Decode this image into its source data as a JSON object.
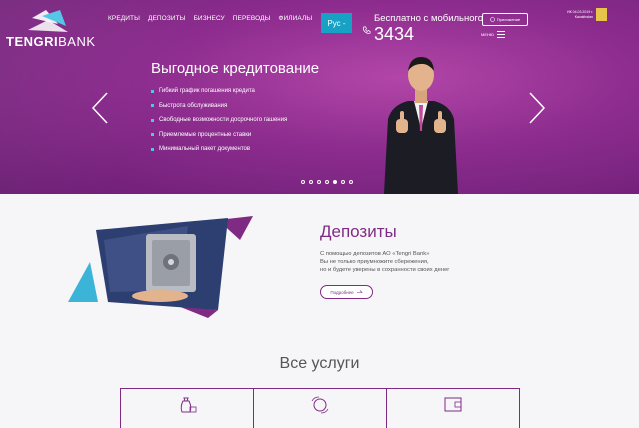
{
  "brand": {
    "name_bold": "TENGRI",
    "name_thin": "BANK"
  },
  "nav": [
    "КРЕДИТЫ",
    "ДЕПОЗИТЫ",
    "БИЗНЕСУ",
    "ПЕРЕВОДЫ",
    "ФИЛИАЛЫ"
  ],
  "header": {
    "lang": "Рус -",
    "phone_caption": "Бесплатно с мобильного",
    "phone_number": "3434",
    "app_button": "Приложение",
    "menu_label": "МЕНЮ",
    "corner_line1": "ИК 04.03.2019 г.",
    "corner_line2": "Kazakhstan"
  },
  "hero": {
    "title": "Выгодное кредитование",
    "bullets": [
      "Гибкий график погашения кредита",
      "Быстрота обслуживания",
      "Свободные возможности досрочного гашения",
      "Приемлемые процентные ставки",
      "Минимальный пакет документов"
    ],
    "slide_count": 7,
    "active_slide": 5
  },
  "deposits": {
    "title": "Депозиты",
    "line1": "С помощью депозитов АО «Tengri Bank»",
    "line2": "Вы не только приумножите сбережения,",
    "line3": "но и будете уверены в сохранности своих денег",
    "button": "Подробнее"
  },
  "services": {
    "title": "Все услуги"
  },
  "colors": {
    "brand_purple": "#7f2b84",
    "accent_cyan": "#17a2c5",
    "hero_bg": "#8c2c8e"
  }
}
